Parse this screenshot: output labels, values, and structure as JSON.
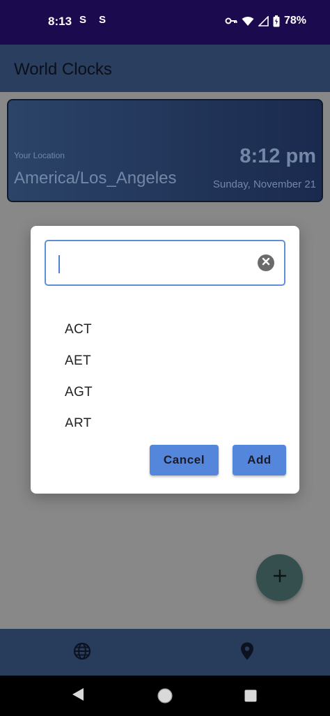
{
  "status_bar": {
    "time": "8:13",
    "notif_icon_1": "S",
    "notif_icon_2": "S",
    "battery": "78%"
  },
  "app_bar": {
    "title": "World Clocks"
  },
  "location_card": {
    "caption": "Your Location",
    "zone": "America/Los_Angeles",
    "time": "8:12 pm",
    "date": "Sunday, November 21"
  },
  "dialog": {
    "search": {
      "value": "",
      "placeholder": ""
    },
    "timezones": [
      "ACT",
      "AET",
      "AGT",
      "ART"
    ],
    "cancel_label": "Cancel",
    "add_label": "Add"
  },
  "icons": {
    "status": [
      "key-icon",
      "wifi-icon",
      "signal-icon",
      "battery-icon"
    ],
    "fab": "plus-icon",
    "bottom_nav": [
      "globe-icon",
      "location-pin-icon"
    ],
    "system_nav": [
      "back-icon",
      "home-icon",
      "recents-icon"
    ],
    "search_clear": "clear-icon"
  },
  "colors": {
    "status_bar": "#1c0a4e",
    "app_bar": "#2a3e5f",
    "accent_button": "#5486dc",
    "fab": "#354f4e"
  }
}
